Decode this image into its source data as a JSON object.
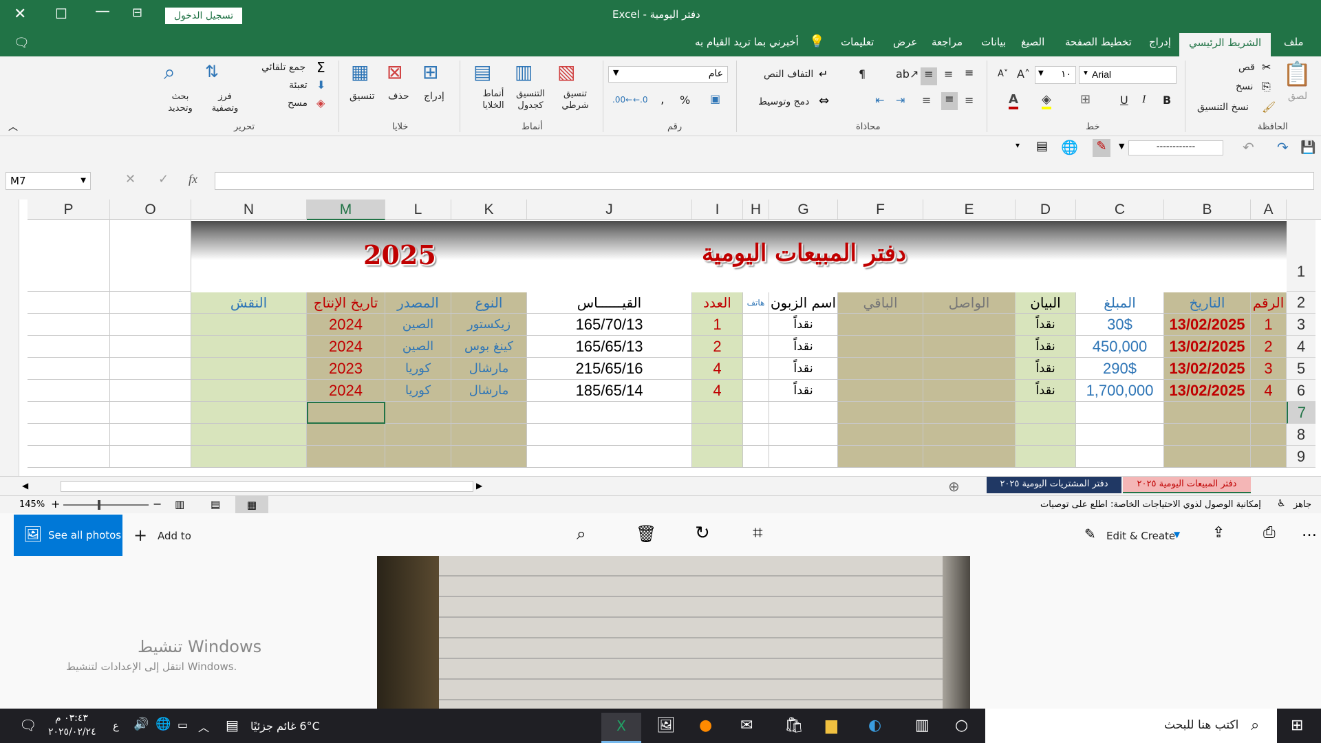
{
  "window": {
    "title": "دفتر اليومية  -  Excel",
    "signin_label": "تسجيل الدخول"
  },
  "tabs": [
    "ملف",
    "الشريط الرئيسي",
    "إدراج",
    "تخطيط الصفحة",
    "الصيغ",
    "بيانات",
    "مراجعة",
    "عرض",
    "تعليمات"
  ],
  "tell_me": "أخبرني بما تريد القيام به",
  "ribbon": {
    "clipboard": {
      "label": "الحافظة",
      "paste": "لصق",
      "cut": "قص",
      "copy": "نسخ",
      "format_painter": "نسخ التنسيق"
    },
    "font": {
      "label": "خط",
      "name": "Arial",
      "size": "١٠"
    },
    "alignment": {
      "label": "محاذاة",
      "wrap": "التفاف النص",
      "merge": "دمج وتوسيط"
    },
    "number": {
      "label": "رقم",
      "format": "عام"
    },
    "styles": {
      "label": "أنماط",
      "conditional": "تنسيق شرطي",
      "table": "التنسيق كجدول",
      "cell_styles": "أنماط الخلايا"
    },
    "cells": {
      "label": "خلايا",
      "insert": "إدراج",
      "delete": "حذف",
      "format": "تنسيق"
    },
    "editing": {
      "label": "تحرير",
      "autosum": "جمع تلقائي",
      "fill": "تعبئة",
      "clear": "مسح",
      "sort": "فرز وتصفية",
      "find": "بحث وتحديد"
    }
  },
  "qat": {
    "border_style": "------------"
  },
  "formula_bar": {
    "cell_ref": "M7",
    "formula": ""
  },
  "columns": [
    "A",
    "B",
    "C",
    "D",
    "E",
    "F",
    "G",
    "H",
    "I",
    "J",
    "K",
    "L",
    "M",
    "N",
    "O",
    "P"
  ],
  "rows": [
    "1",
    "2",
    "3",
    "4",
    "5",
    "6",
    "7",
    "8",
    "9"
  ],
  "banner": {
    "title": "دفتر المبيعات اليومية",
    "year": "2025"
  },
  "headers": {
    "A": "الرقم",
    "B": "التاريخ",
    "C": "المبلغ",
    "D": "البيان",
    "E": "الواصل",
    "F": "الباقي",
    "G": "اسم الزبون",
    "H": "هاتف",
    "I": "العدد",
    "J": "القيــــــاس",
    "K": "النوع",
    "L": "المصدر",
    "M": "تاريخ الإنتاج",
    "N": "النقش"
  },
  "records": [
    {
      "A": "1",
      "B": "13/02/2025",
      "C": "30$",
      "D": "نقداً",
      "G": "نقداً",
      "I": "1",
      "J": "165/70/13",
      "K": "زيكستور",
      "L": "الصين",
      "M": "2024"
    },
    {
      "A": "2",
      "B": "13/02/2025",
      "C": "450,000",
      "D": "نقداً",
      "G": "نقداً",
      "I": "2",
      "J": "165/65/13",
      "K": "كينغ بوس",
      "L": "الصين",
      "M": "2024"
    },
    {
      "A": "3",
      "B": "13/02/2025",
      "C": "290$",
      "D": "نقداً",
      "G": "نقداً",
      "I": "4",
      "J": "215/65/16",
      "K": "مارشال",
      "L": "كوريا",
      "M": "2023"
    },
    {
      "A": "4",
      "B": "13/02/2025",
      "C": "1,700,000",
      "D": "نقداً",
      "G": "نقداً",
      "I": "4",
      "J": "185/65/14",
      "K": "مارشال",
      "L": "كوريا",
      "M": "2024"
    }
  ],
  "sheets": [
    "دفتر المبيعات اليومية ٢٠٢٥",
    "دفتر المشتريات اليومية ٢٠٢٥"
  ],
  "status": {
    "ready": "جاهز",
    "accessibility": "إمكانية الوصول لذوي الاحتياجات الخاصة: اطلع على توصيات",
    "zoom": "145%"
  },
  "photos": {
    "see_all": "See all photos",
    "add_to": "Add to",
    "edit_create": "Edit & Create"
  },
  "activation": {
    "title": "تنشيط Windows",
    "subtitle": "انتقل إلى الإعدادات لتنشيط Windows."
  },
  "taskbar": {
    "search": "اكتب هنا للبحث",
    "weather": "6°C  غائم جزئيًا",
    "time": "٠٣:٤٣ م",
    "date": "٢٠٢٥/٠٢/٢٤",
    "lang": "ع"
  },
  "colors": {
    "excel_green": "#217346",
    "red": "#c00000",
    "blue": "#2e75b6",
    "tan": "#c4bd97",
    "light_green": "#d8e4bc"
  }
}
